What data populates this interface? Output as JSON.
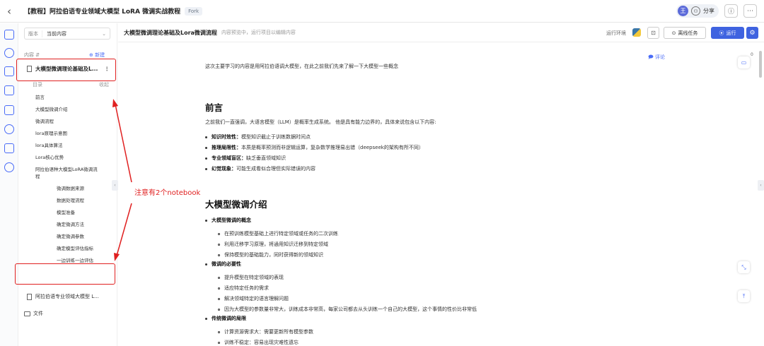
{
  "header": {
    "back_glyph": "‹",
    "title": "【教程】阿拉伯语专业领域大模型 LoRA 微调实战教程",
    "fork_badge": "Fork",
    "user_initial": "王",
    "share_label": "分享",
    "info_glyph": "ⓘ",
    "more_glyph": "⋯"
  },
  "sidebar": {
    "version_label": "版本",
    "version_value": "当前内容",
    "content_label": "内容 ⇵",
    "new_label": "⊕ 新建",
    "notebook_1": "大模型微调理论基础及L...",
    "toc_label": "目录",
    "toc_collapse": "收起",
    "toc_items": [
      "前言",
      "大模型微调介绍",
      "微调流程",
      "lora原理示意图",
      "lora具体算法",
      "Lora核心优势",
      "阿拉伯语种大模型LoRA微调流",
      "程",
      "微调数据来源",
      "数据处理流程",
      "模型准备",
      "确定微调方法",
      "确定微调参数",
      "确定模型评估指标",
      "一边训练一边评估"
    ],
    "notebook_2": "阿拉伯语专业领域大模型 L...",
    "files_label": "文件"
  },
  "annotation": {
    "text": "注意有2个notebook"
  },
  "main_bar": {
    "notebook_name": "大模型微调理论基础及Lora微调流程",
    "hint": "内容预览中，运行项目以编辑内容",
    "env_label": "运行环境",
    "offline_label": "离线任务",
    "run_label": "运行"
  },
  "document": {
    "comment_label": "评论",
    "comment_count": "0",
    "intro": "这次主要学习的内容是用阿拉伯语调大模型，在此之前我们先来了解一下大模型一些概念",
    "h_preface": "前言",
    "preface_para": "之前我们一直强调，大语言模型（LLM）是概率生成系统。 他是具有能力边界的，具体来说包含以下内容:",
    "preface_bullets": [
      {
        "bold": "知识时效性：",
        "text": "模型知识截止于训练数据时间点"
      },
      {
        "bold": "推理局限性：",
        "text": "本质是概率预测而非逻辑运算，复杂数学推理易出错（deepseek的架构有所不同）"
      },
      {
        "bold": "专业领域盲区：",
        "text": "缺乏垂直领域知识"
      },
      {
        "bold": "幻觉现象：",
        "text": "可能生成看似合理但实际错误的内容"
      }
    ],
    "h_intro": "大模型微调介绍",
    "concept_title": "大模型微调的概念",
    "concept_items": [
      "在预训练模型基础上进行特定领域或任务的二次训练",
      "利用迁移学习原理，将通用知识迁移到特定领域",
      "保持模型的基础能力，同时获得新的领域知识"
    ],
    "necessity_title": "微调的必要性",
    "necessity_items": [
      "提升模型在特定领域的表现",
      "适应特定任务的需求",
      "解决领域特定的语言理解问题",
      "因为大模型的参数量非常大，训练成本非常高，每家公司都去从头训练一个自己的大模型，这个事情的性价比非常低"
    ],
    "limit_title": "传统微调的局限",
    "limit_items": [
      "计算资源需求大：需要更新所有模型参数",
      "训练不稳定：容易出现灾难性遗忘"
    ]
  },
  "colors": {
    "accent": "#3f63e0",
    "annotation": "#e02020"
  }
}
